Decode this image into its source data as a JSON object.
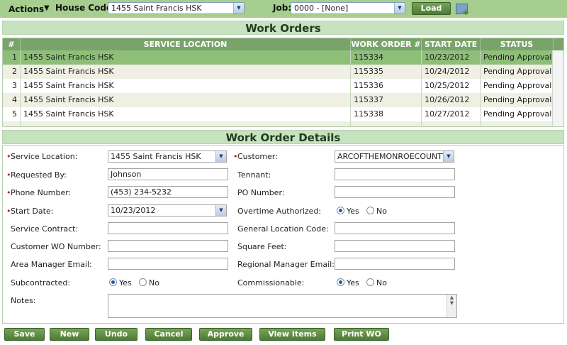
{
  "toolbar": {
    "actions_label": "Actions",
    "house_code_label": "House Code:",
    "house_code_value": "1455 Saint Francis HSK",
    "job_label": "Job:",
    "job_value": "0000 - [None]",
    "load_label": "Load"
  },
  "work_orders": {
    "title": "Work Orders",
    "columns": [
      "#",
      "SERVICE LOCATION",
      "WORK ORDER #",
      "START DATE",
      "STATUS"
    ],
    "rows": [
      {
        "num": "1",
        "location": "1455 Saint Francis HSK",
        "order": "115334",
        "date": "10/23/2012",
        "status": "Pending Approval"
      },
      {
        "num": "2",
        "location": "1455 Saint Francis HSK",
        "order": "115335",
        "date": "10/24/2012",
        "status": "Pending Approval"
      },
      {
        "num": "3",
        "location": "1455 Saint Francis HSK",
        "order": "115336",
        "date": "10/25/2012",
        "status": "Pending Approval"
      },
      {
        "num": "4",
        "location": "1455 Saint Francis HSK",
        "order": "115337",
        "date": "10/26/2012",
        "status": "Pending Approval"
      },
      {
        "num": "5",
        "location": "1455 Saint Francis HSK",
        "order": "115338",
        "date": "10/27/2012",
        "status": "Pending Approval"
      }
    ],
    "selected_row": 1
  },
  "details": {
    "title": "Work Order Details",
    "service_location_label": "Service Location:",
    "service_location_value": "1455 Saint Francis HSK",
    "customer_label": "Customer:",
    "customer_value": "ARCOFTHEMONROECOUNTY",
    "requested_by_label": "Requested By:",
    "requested_by_value": "Johnson",
    "tennant_label": "Tennant:",
    "tennant_value": "",
    "phone_label": "Phone Number:",
    "phone_value": "(453) 234-5232",
    "po_label": "PO Number:",
    "po_value": "",
    "start_date_label": "Start Date:",
    "start_date_value": "10/23/2012",
    "overtime_label": "Overtime Authorized:",
    "overtime_yes": "Yes",
    "overtime_no": "No",
    "service_contract_label": "Service Contract:",
    "service_contract_value": "",
    "general_location_label": "General Location Code:",
    "general_location_value": "",
    "customer_wo_label": "Customer WO Number:",
    "customer_wo_value": "",
    "square_feet_label": "Square Feet:",
    "square_feet_value": "",
    "area_manager_label": "Area Manager Email:",
    "area_manager_value": "",
    "regional_manager_label": "Regional Manager Email:",
    "regional_manager_value": "",
    "subcontracted_label": "Subcontracted:",
    "subcontracted_yes": "Yes",
    "subcontracted_no": "No",
    "commissionable_label": "Commissionable:",
    "commissionable_yes": "Yes",
    "commissionable_no": "No",
    "notes_label": "Notes:",
    "required_marker": "•"
  },
  "actions": {
    "save": "Save",
    "new": "New",
    "undo": "Undo",
    "cancel": "Cancel",
    "approve": "Approve",
    "view_items": "View Items",
    "print_wo": "Print WO"
  },
  "colors": {
    "toolbar_bg": "#a6cf8f",
    "header_bg": "#7aa36b",
    "selected_row": "#8dbf78",
    "button": "#5b8a3f",
    "required": "#cc1111"
  }
}
